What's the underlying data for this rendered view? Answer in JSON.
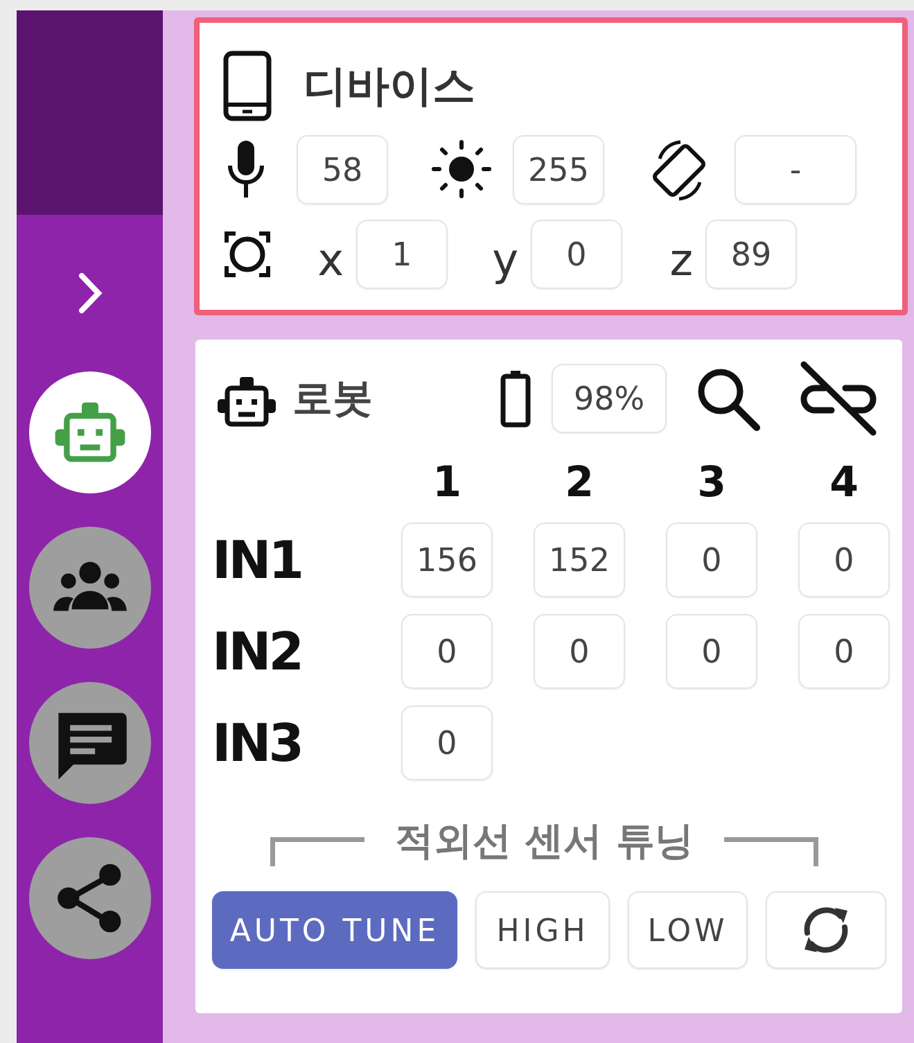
{
  "sidebar": {
    "items": [
      {
        "kind": "robot",
        "selected": true
      },
      {
        "kind": "group",
        "selected": false
      },
      {
        "kind": "chat",
        "selected": false
      },
      {
        "kind": "share",
        "selected": false
      }
    ]
  },
  "device": {
    "title": "디바이스",
    "highlighted": true,
    "sensors": [
      {
        "kind": "mic",
        "value": "58"
      },
      {
        "kind": "light",
        "value": "255"
      },
      {
        "kind": "orientation",
        "value": "-"
      }
    ],
    "accel": [
      {
        "axis": "x",
        "value": "1"
      },
      {
        "axis": "y",
        "value": "0"
      },
      {
        "axis": "z",
        "value": "89"
      }
    ]
  },
  "robot": {
    "title": "로봇",
    "battery": "98%",
    "columns": [
      "1",
      "2",
      "3",
      "4"
    ],
    "rows": [
      {
        "label": "IN1",
        "values": [
          "156",
          "152",
          "0",
          "0"
        ]
      },
      {
        "label": "IN2",
        "values": [
          "0",
          "0",
          "0",
          "0"
        ]
      },
      {
        "label": "IN3",
        "values": [
          "0"
        ]
      }
    ],
    "tuning_title": "적외선 센서 튜닝",
    "buttons": [
      {
        "kind": "text",
        "label": "AUTO TUNE",
        "selected": true
      },
      {
        "kind": "text",
        "label": "HIGH",
        "selected": false
      },
      {
        "kind": "text",
        "label": "LOW",
        "selected": false
      },
      {
        "kind": "refresh",
        "selected": false
      }
    ]
  }
}
